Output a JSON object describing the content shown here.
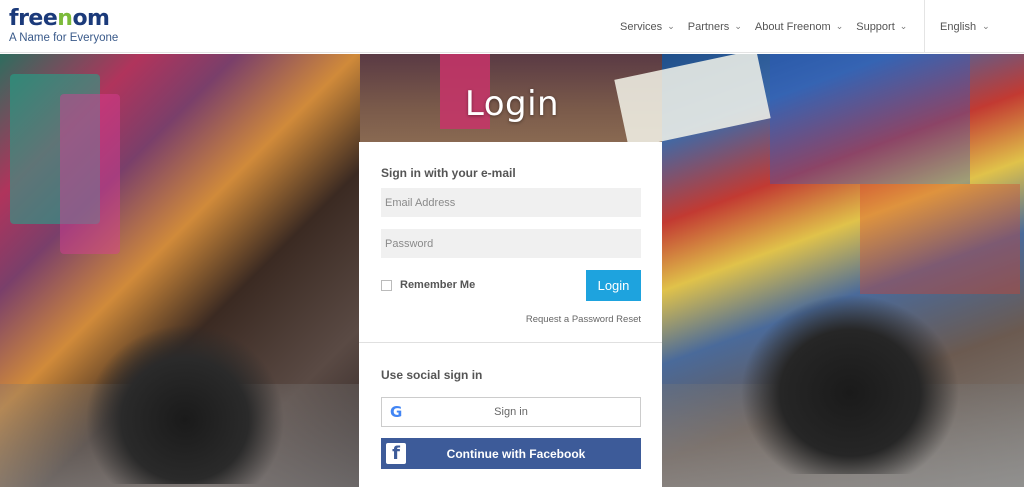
{
  "header": {
    "logo_text": "freenom",
    "tagline": "A Name for Everyone",
    "nav": [
      {
        "label": "Services"
      },
      {
        "label": "Partners"
      },
      {
        "label": "About Freenom"
      },
      {
        "label": "Support"
      }
    ],
    "language": "English"
  },
  "hero": {
    "title": "Login"
  },
  "login_card": {
    "email_section_title": "Sign in with your e-mail",
    "email_placeholder": "Email Address",
    "password_placeholder": "Password",
    "remember_label": "Remember Me",
    "login_button": "Login",
    "reset_link": "Request a Password Reset",
    "social_section_title": "Use social sign in",
    "google_button": "Sign in",
    "facebook_button": "Continue with Facebook"
  },
  "colors": {
    "brand_blue": "#1b3a7a",
    "brand_green": "#7cbb3a",
    "login_button": "#1ea3de",
    "facebook_blue": "#3d5b99"
  },
  "icons": {
    "google": "google-g-icon",
    "facebook": "facebook-f-icon",
    "dropdown": "chevron-down-icon"
  }
}
